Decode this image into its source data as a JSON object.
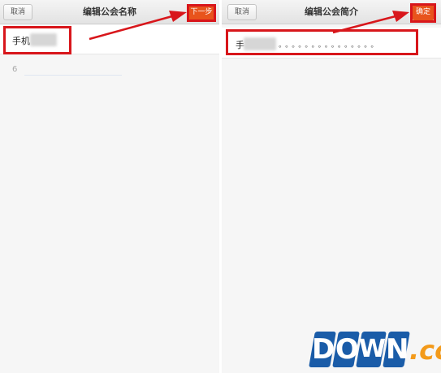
{
  "left_screen": {
    "cancel_label": "取消",
    "title": "编辑公会名称",
    "next_label": "下一步",
    "name_value": "手机",
    "counter": "6"
  },
  "right_screen": {
    "cancel_label": "取消",
    "title": "编辑公会简介",
    "confirm_label": "确定",
    "intro_value": "手",
    "intro_dots": "。。。。。。。。。。。。。。。"
  },
  "watermark": {
    "letters": [
      "D",
      "O",
      "W",
      "N"
    ],
    "suffix": ".cc"
  },
  "colors": {
    "accent": "#e8541c",
    "annotation": "#d8161b",
    "watermark_blue": "#1a5ca8",
    "watermark_orange": "#f39a1a"
  }
}
